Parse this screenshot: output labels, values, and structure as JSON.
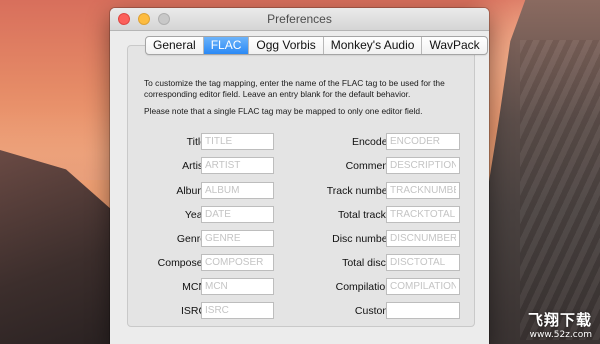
{
  "window": {
    "title": "Preferences"
  },
  "tabs": [
    {
      "label": "General",
      "active": false
    },
    {
      "label": "FLAC",
      "active": true
    },
    {
      "label": "Ogg Vorbis",
      "active": false
    },
    {
      "label": "Monkey's Audio",
      "active": false
    },
    {
      "label": "WavPack",
      "active": false
    }
  ],
  "panel": {
    "description": "To customize the tag mapping, enter the name of the FLAC tag to be used for the corresponding editor field.  Leave an entry blank for the default behavior.",
    "note": "Please note that a single FLAC tag may be mapped to only one editor field.",
    "left_fields": [
      {
        "label": "Title:",
        "value": "",
        "placeholder": "TITLE"
      },
      {
        "label": "Artist:",
        "value": "",
        "placeholder": "ARTIST"
      },
      {
        "label": "Album:",
        "value": "",
        "placeholder": "ALBUM"
      },
      {
        "label": "Year:",
        "value": "",
        "placeholder": "DATE"
      },
      {
        "label": "Genre:",
        "value": "",
        "placeholder": "GENRE"
      },
      {
        "label": "Composer:",
        "value": "",
        "placeholder": "COMPOSER"
      },
      {
        "label": "MCN:",
        "value": "",
        "placeholder": "MCN"
      },
      {
        "label": "ISRC:",
        "value": "",
        "placeholder": "ISRC"
      }
    ],
    "right_fields": [
      {
        "label": "Encoder:",
        "value": "",
        "placeholder": "ENCODER"
      },
      {
        "label": "Comment:",
        "value": "",
        "placeholder": "DESCRIPTION"
      },
      {
        "label": "Track number:",
        "value": "",
        "placeholder": "TRACKNUMBER"
      },
      {
        "label": "Total tracks:",
        "value": "",
        "placeholder": "TRACKTOTAL"
      },
      {
        "label": "Disc number:",
        "value": "",
        "placeholder": "DISCNUMBER"
      },
      {
        "label": "Total discs:",
        "value": "",
        "placeholder": "DISCTOTAL"
      },
      {
        "label": "Compilation:",
        "value": "",
        "placeholder": "COMPILATION"
      },
      {
        "label": "Custom:",
        "value": "",
        "placeholder": ""
      }
    ]
  },
  "watermark": {
    "main": "飞翔下载",
    "sub": "www.52z.com"
  },
  "colors": {
    "accent": "#2a89f5",
    "close": "#fc605b",
    "minimize": "#fdbc40"
  }
}
